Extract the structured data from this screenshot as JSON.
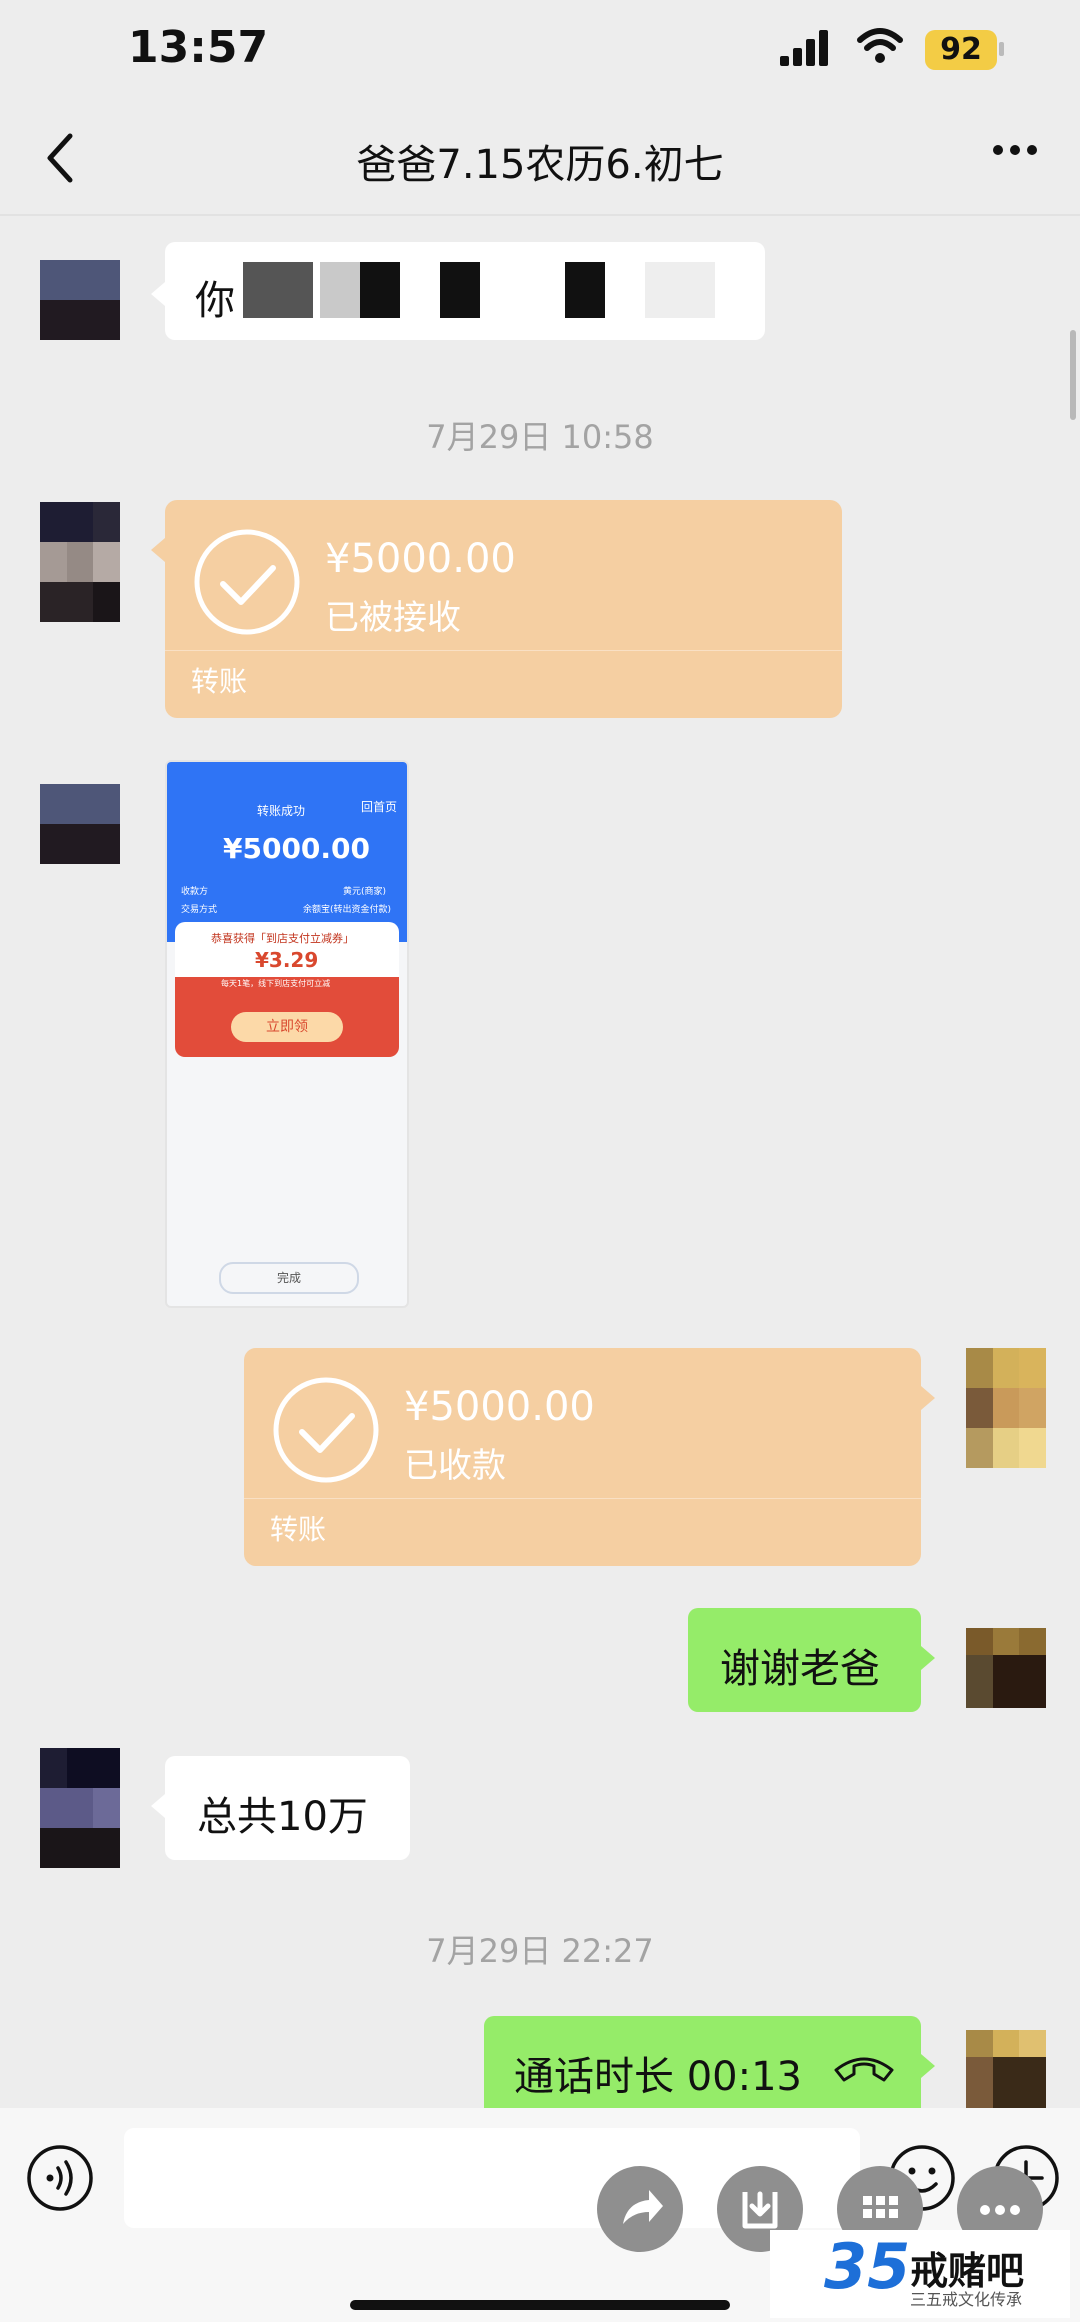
{
  "status_bar": {
    "time": "13:57",
    "battery": "92"
  },
  "nav": {
    "title": "爸爸7.15农历6.初七"
  },
  "messages": {
    "first_partial": "你",
    "timestamp_1": "7月29日 10:58",
    "transfer_1": {
      "amount": "¥5000.00",
      "status": "已被接收",
      "label": "转账"
    },
    "screenshot": {
      "header_status": "转账成功",
      "back_home": "回首页",
      "amount": "¥5000.00",
      "row1_left": "收款方",
      "row1_right": "黄元(商家)",
      "row2_left": "交易方式",
      "row2_right": "余额宝(转出资金付款)",
      "coupon_title": "恭喜获得「到店支付立减券」",
      "coupon_value": "¥3.29",
      "coupon_desc": "每天1笔，线下到店支付可立减",
      "claim": "立即领",
      "done": "完成"
    },
    "transfer_2": {
      "amount": "¥5000.00",
      "status": "已收款",
      "label": "转账"
    },
    "thanks": "谢谢老爸",
    "total": "总共10万",
    "timestamp_2": "7月29日 22:27",
    "call": "通话时长 00:13"
  },
  "watermark": {
    "title": "戒赌吧",
    "number": "35",
    "subtitle": "三五戒文化传承"
  },
  "colors": {
    "transfer_bg": "#f5cfa2",
    "green_bubble": "#95ec69",
    "background": "#ededed"
  }
}
